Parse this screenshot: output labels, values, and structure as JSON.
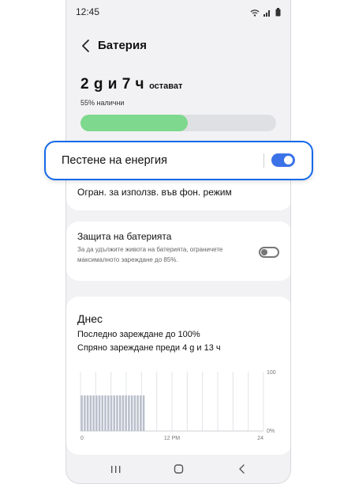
{
  "status_bar": {
    "time": "12:45",
    "icons": [
      "wifi-icon",
      "signal-icon",
      "battery-icon"
    ]
  },
  "header": {
    "title": "Батерия",
    "back_icon": "chevron-left-icon"
  },
  "battery": {
    "remaining_big": "2 g и 7 ч",
    "remaining_small": "остават",
    "available": "55% налични",
    "level_percent": 55,
    "fill_color": "#7ed88d"
  },
  "power_saving": {
    "label": "Пестене на енергия",
    "enabled": true,
    "sub_label": "Огран. за използв. във фон. режим",
    "accent_color": "#1769e8"
  },
  "battery_protection": {
    "title": "Защита на батерията",
    "description": "За да удължите живота на батерията, ограничете максималното зареждане до 85%.",
    "enabled": false
  },
  "today": {
    "title": "Днес",
    "last_charge": "Последно зареждане до 100%",
    "stopped_charge": "Спряно зареждане преди 4 g и 13 ч"
  },
  "chart_data": {
    "type": "bar",
    "x_tick_labels": [
      "0",
      "12 PM",
      "24"
    ],
    "y_tick_labels": [
      "100",
      "0%"
    ],
    "ylim": [
      0,
      100
    ],
    "xlim": [
      0,
      24
    ],
    "bars": {
      "x_start": 0,
      "x_end": 8.5,
      "bar_count": 22,
      "value": 60,
      "color": "#b9bfcc"
    },
    "grid": true,
    "gridline_hours": [
      0,
      2,
      4,
      6,
      8,
      10,
      12,
      14,
      16,
      18,
      20,
      22,
      24
    ]
  },
  "navbar": {
    "icons": [
      "recent-apps-icon",
      "home-icon",
      "back-nav-icon"
    ]
  }
}
